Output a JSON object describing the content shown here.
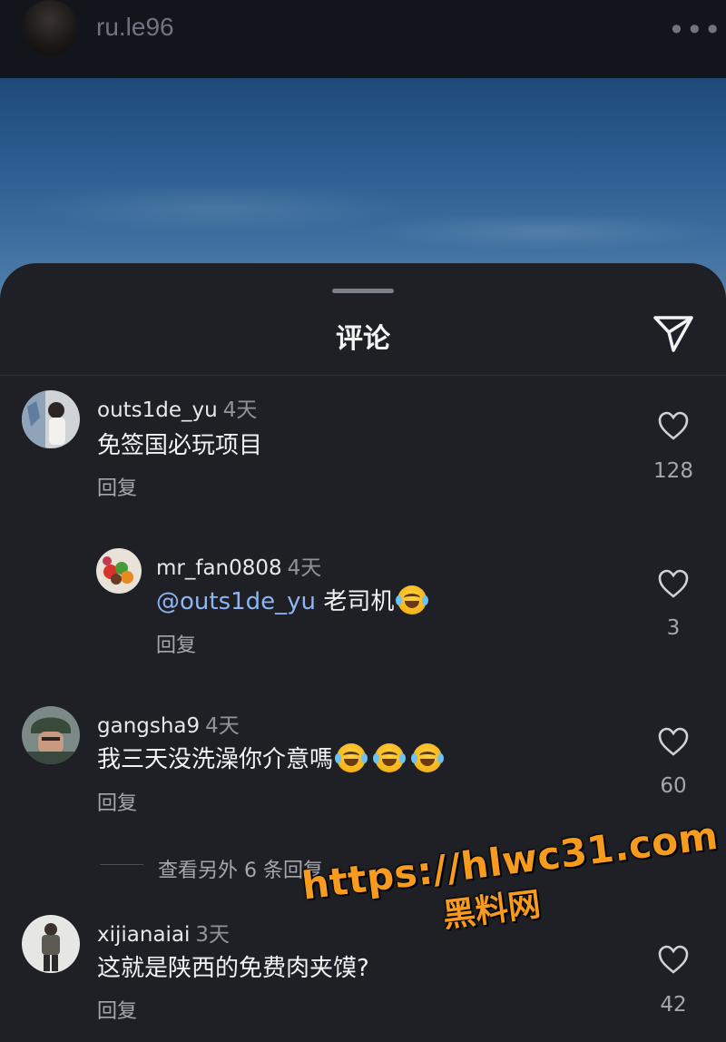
{
  "header": {
    "username": "ru.le96",
    "more_icon": "more-dots-icon",
    "more_glyph": "•••"
  },
  "sheet": {
    "title": "评论",
    "share_icon": "send-icon"
  },
  "comments": [
    {
      "username": "outs1de_yu",
      "time": "4天",
      "text": "免签国必玩项目",
      "reply_label": "回复",
      "likes": "128"
    },
    {
      "username": "mr_fan0808",
      "time": "4天",
      "mention": "@outs1de_yu",
      "text": "老司机",
      "emoji": "laughing-tears-emoji",
      "reply_label": "回复",
      "likes": "3"
    },
    {
      "username": "gangsha9",
      "time": "4天",
      "text": "我三天没洗澡你介意嗎",
      "emoji": "laughing-tears-emoji",
      "reply_label": "回复",
      "likes": "60"
    },
    {
      "username": "xijianaiai",
      "time": "3天",
      "text": "这就是陕西的免费肉夹馍?",
      "reply_label": "回复",
      "likes": "42"
    }
  ],
  "more_replies": "查看另外 6 条回复",
  "watermark": {
    "url": "https://hlwc31.com",
    "name": "黑料网"
  },
  "colors": {
    "background": "#1e2026",
    "mention": "#8eb4f2",
    "watermark": "#f79b1e"
  }
}
